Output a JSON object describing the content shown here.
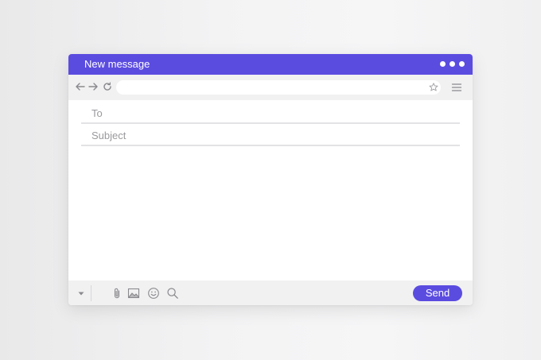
{
  "window": {
    "title": "New message",
    "accent_color": "#5b4ce0"
  },
  "titlebar": {
    "window_controls": [
      "dot",
      "dot",
      "dot"
    ]
  },
  "navbar": {
    "icons": [
      "back-arrow-icon",
      "forward-arrow-icon",
      "reload-icon",
      "star-icon",
      "menu-icon"
    ],
    "url_value": ""
  },
  "compose": {
    "to_placeholder": "To",
    "to_value": "",
    "subject_placeholder": "Subject",
    "subject_value": "",
    "body_value": ""
  },
  "footer": {
    "icons": [
      "dropdown-caret-icon",
      "paperclip-icon",
      "image-icon",
      "emoji-icon",
      "search-icon"
    ],
    "send_label": "Send"
  }
}
